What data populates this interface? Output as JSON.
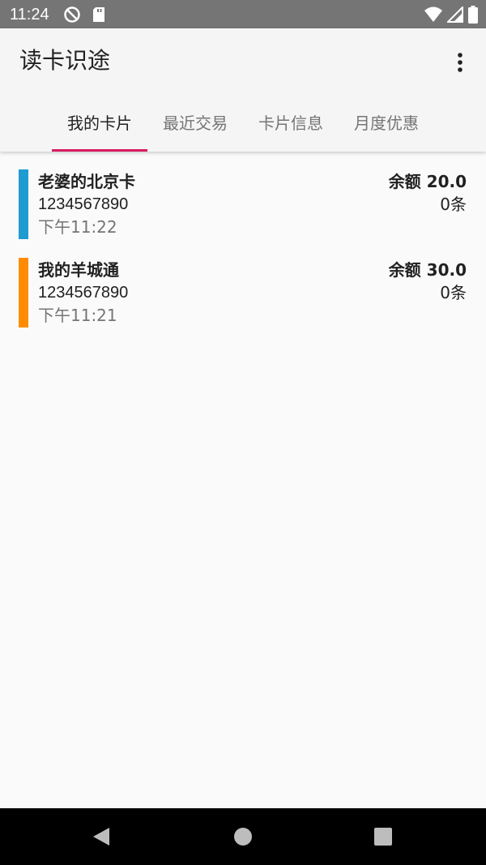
{
  "status_bar": {
    "time": "11:24",
    "left_icons": [
      "do-not-disturb-icon",
      "sd-card-icon"
    ],
    "right_icons": [
      "wifi-icon",
      "signal-icon",
      "battery-icon"
    ]
  },
  "app_bar": {
    "title": "读卡识途",
    "menu_icon": "more-vert-icon"
  },
  "tabs": [
    {
      "label": "我的卡片",
      "active": true
    },
    {
      "label": "最近交易",
      "active": false
    },
    {
      "label": "卡片信息",
      "active": false
    },
    {
      "label": "月度优惠",
      "active": false
    }
  ],
  "accent_color": "#d81b60",
  "cards": [
    {
      "name": "老婆的北京卡",
      "number": "1234567890",
      "time": "下午11:22",
      "balance": "余额 20.0",
      "count": "0条",
      "color": "#1e9bd1"
    },
    {
      "name": "我的羊城通",
      "number": "1234567890",
      "time": "下午11:21",
      "balance": "余额 30.0",
      "count": "0条",
      "color": "#ff8c00"
    }
  ],
  "nav_bar": {
    "buttons": [
      "back-icon",
      "home-icon",
      "recents-icon"
    ]
  }
}
